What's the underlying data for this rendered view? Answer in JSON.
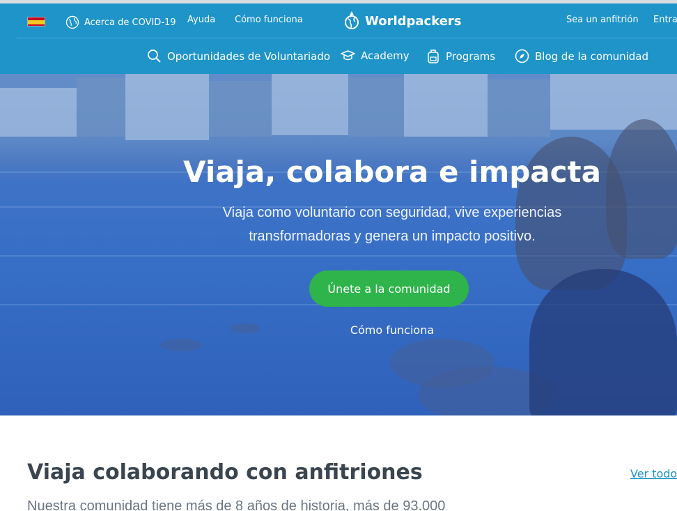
{
  "topbar": {
    "language_flag": "spain-flag",
    "covid_link": "Acerca de COVID-19",
    "help_link": "Ayuda",
    "how_it_works_link": "Cómo funciona",
    "brand": "Worldpackers",
    "host_link": "Sea un anfitrión",
    "login_link": "Entrar"
  },
  "nav": {
    "items": [
      {
        "label": "Oportunidades de Voluntariado",
        "icon": "search-icon"
      },
      {
        "label": "Academy",
        "icon": "graduation-cap-icon"
      },
      {
        "label": "Programs",
        "icon": "backpack-icon"
      },
      {
        "label": "Blog de la comunidad",
        "icon": "compass-icon"
      }
    ]
  },
  "hero": {
    "title": "Viaja, colabora e impacta",
    "subtitle_line1": "Viaja como voluntario con seguridad, vive experiencias",
    "subtitle_line2": "transformadoras y genera un impacto positivo.",
    "cta_label": "Únete a la comunidad",
    "secondary_link": "Cómo funciona"
  },
  "section": {
    "title": "Viaja colaborando con anfitriones",
    "see_all": "Ver todos",
    "subtitle": "Nuestra comunidad tiene más de 8 años de historia, más de 93.000"
  },
  "colors": {
    "header_blue": "#1e94c9",
    "cta_green": "#2eb44a",
    "heading_dark": "#3a4550"
  }
}
